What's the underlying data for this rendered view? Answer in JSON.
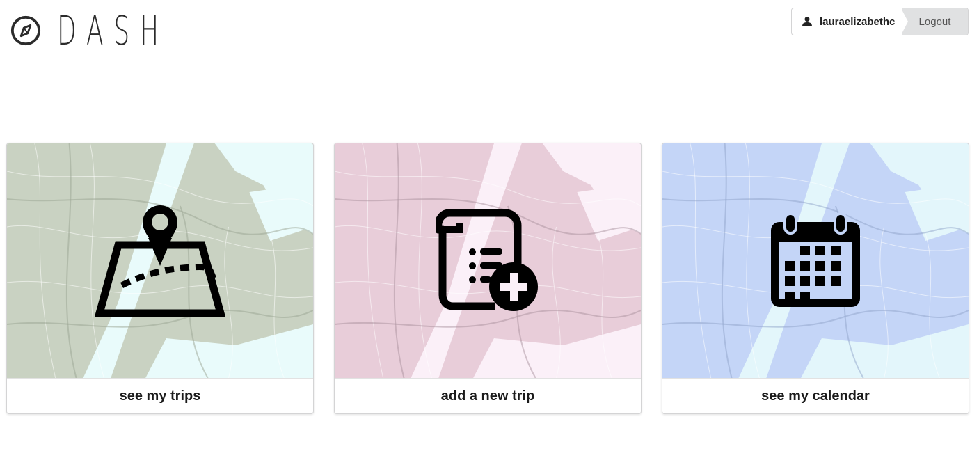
{
  "header": {
    "logo_text": "DASH",
    "username": "lauraelizabethc",
    "logout_label": "Logout"
  },
  "cards": [
    {
      "label": "see my trips",
      "tint": "#c9d2c2",
      "water": "#e9fbfb",
      "icon": "map-route-icon"
    },
    {
      "label": "add a new trip",
      "tint": "#e8cdd9",
      "water": "#fbf0f8",
      "icon": "itinerary-add-icon"
    },
    {
      "label": "see my calendar",
      "tint": "#c4d5f7",
      "water": "#e3f6fb",
      "icon": "calendar-icon"
    }
  ]
}
